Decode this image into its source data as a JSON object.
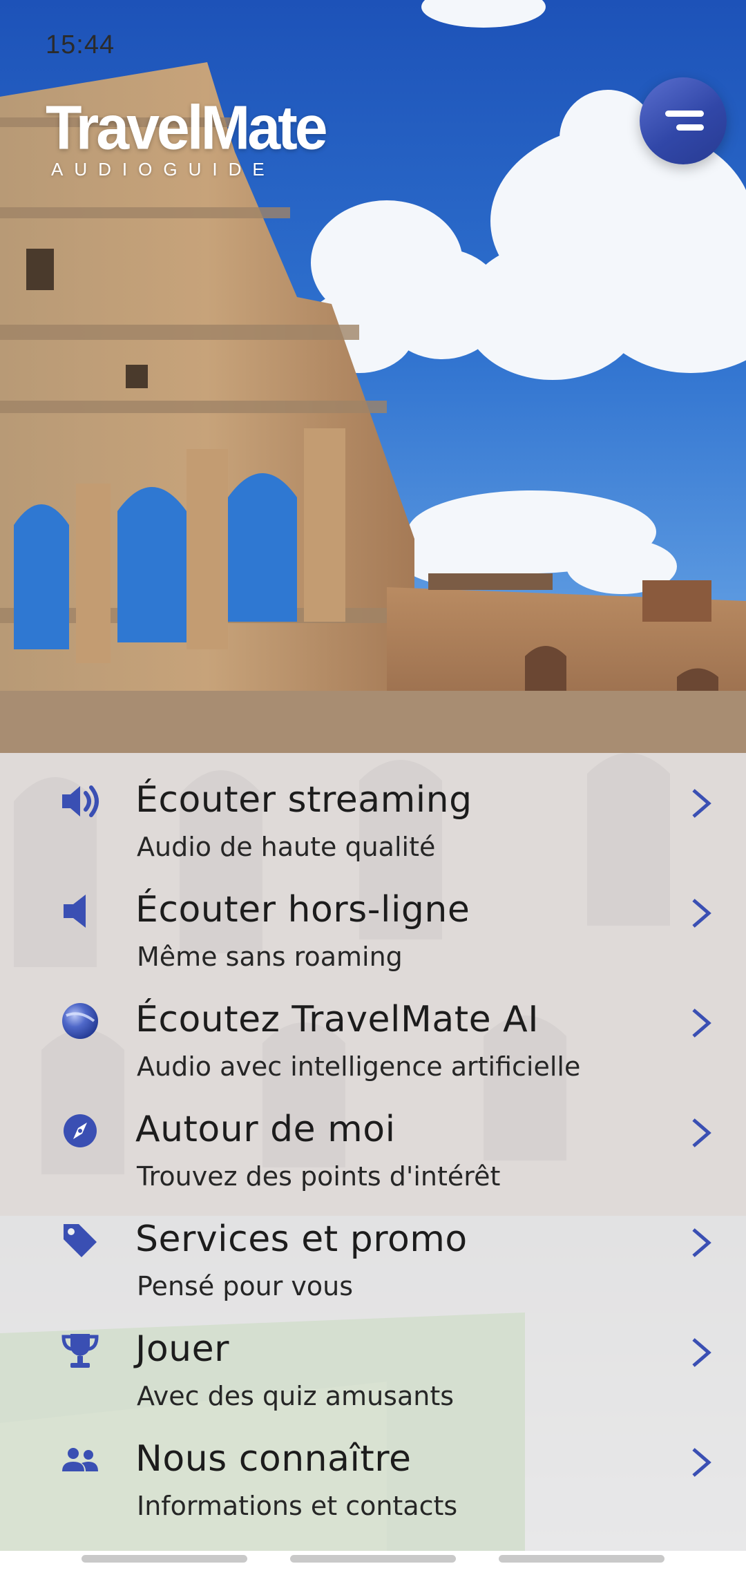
{
  "status_bar": {
    "time": "15:44"
  },
  "app": {
    "logo_title": "TravelMate",
    "logo_subtitle": "AUDIOGUIDE"
  },
  "colors": {
    "accent": "#3a4fb3",
    "panel_bg": "#eceef1",
    "text": "#1c1c1c"
  },
  "menu": [
    {
      "icon": "speaker-wave-icon",
      "title": "Écouter streaming",
      "subtitle": "Audio de haute qualité"
    },
    {
      "icon": "speaker-icon",
      "title": "Écouter hors-ligne",
      "subtitle": "Même sans roaming"
    },
    {
      "icon": "ai-sphere-icon",
      "title": "Écoutez TravelMate AI",
      "subtitle": "Audio avec intelligence artificielle"
    },
    {
      "icon": "compass-icon",
      "title": "Autour de moi",
      "subtitle": "Trouvez des points d'intérêt"
    },
    {
      "icon": "tag-icon",
      "title": "Services et promo",
      "subtitle": "Pensé pour vous"
    },
    {
      "icon": "trophy-icon",
      "title": "Jouer",
      "subtitle": "Avec des quiz amusants"
    },
    {
      "icon": "people-icon",
      "title": "Nous connaître",
      "subtitle": "Informations et contacts"
    }
  ]
}
